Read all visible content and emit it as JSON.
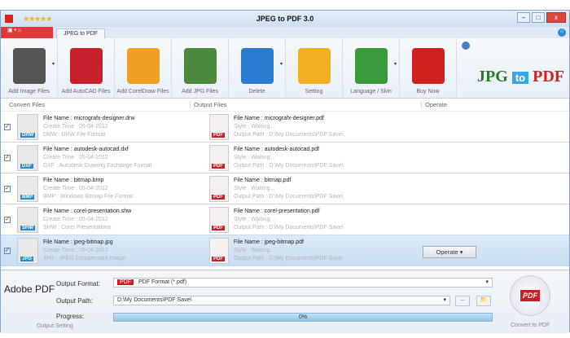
{
  "window": {
    "title": "JPEG to PDF 3.0",
    "rating": "★★★★★",
    "min": "–",
    "max": "□",
    "close": "x"
  },
  "tabs": {
    "app_menu": "▣ • ⌂",
    "active": "JPEG to PDF",
    "home": "⌂"
  },
  "toolbar": [
    {
      "label": "Add Image Files",
      "icon": "add-image-icon",
      "color": "#555555",
      "dropdown": true
    },
    {
      "label": "Add AutoCAD Files",
      "icon": "autocad-icon",
      "color": "#c8202a",
      "dropdown": false
    },
    {
      "label": "Add CorelDraw Files",
      "icon": "balloon-icon",
      "color": "#f0a020",
      "dropdown": false
    },
    {
      "label": "Add JPG Files",
      "icon": "jpg-image-icon",
      "color": "#4a8a3a",
      "dropdown": false
    },
    {
      "label": "Delete",
      "icon": "recycle-bin-icon",
      "color": "#2a7ad0",
      "dropdown": true
    },
    {
      "label": "Setting",
      "icon": "gears-icon",
      "color": "#f0b020",
      "dropdown": false
    },
    {
      "label": "Language / Skin",
      "icon": "abc-icon",
      "color": "#3a9a3a",
      "dropdown": true
    },
    {
      "label": "Buy Now",
      "icon": "gift-icon",
      "color": "#d02020",
      "dropdown": false
    }
  ],
  "logo": {
    "jpg": "JPG",
    "to": "to",
    "pdf": "PDF"
  },
  "columns": {
    "convert": "Convert Files",
    "output": "Output Files",
    "operate": "Operate"
  },
  "rows": [
    {
      "ext": "DRW",
      "name": "File Name : micrografx-designer.drw",
      "time": "Create Time : 05-04-2012",
      "type": "DRW : DRW File Format",
      "out_name": "File Name : micrografx-designer.pdf",
      "style": "Style : Waiting...",
      "path": "Output Path : D:\\My Documents\\PDF Save\\"
    },
    {
      "ext": "DXF",
      "name": "File Name : autodesk-autocad.dxf",
      "time": "Create Time : 05-04-2012",
      "type": "DXF : Autodesk Drawing Exchange Format",
      "out_name": "File Name : autodesk-autocad.pdf",
      "style": "Style : Waiting...",
      "path": "Output Path : D:\\My Documents\\PDF Save\\"
    },
    {
      "ext": "BMP",
      "name": "File Name : bitmap.bmp",
      "time": "Create Time : 05-04-2012",
      "type": "BMP : Windows Bitmap File Format",
      "out_name": "File Name : bitmap.pdf",
      "style": "Style : Waiting...",
      "path": "Output Path : D:\\My Documents\\PDF Save\\"
    },
    {
      "ext": "SHW",
      "name": "File Name : corel-presentation.shw",
      "time": "Create Time : 05-04-2012",
      "type": "SHW : Corel Presentations",
      "out_name": "File Name : corel-presentation.pdf",
      "style": "Style : Waiting...",
      "path": "Output Path : D:\\My Documents\\PDF Save\\"
    },
    {
      "ext": "JPG",
      "name": "File Name : jpeg-bitmap.jpg",
      "time": "Create Time : 05-04-2012",
      "type": "JPG : JPEG Compressed Image",
      "out_name": "File Name : jpeg-bitmap.pdf",
      "style": "Style : Waiting...",
      "path": "Output Path : D:\\My Documents\\PDF Save\\"
    }
  ],
  "operate_button": "Operate ▾",
  "pdf_badge": "PDF",
  "bottom": {
    "adobe": "Adobe PDF",
    "format_label": "Output Format:",
    "format_value": "PDF Format (*.pdf)",
    "path_label": "Output Path:",
    "path_value": "D:\\My Documents\\PDF Save\\",
    "progress_label": "Progress:",
    "progress_text": "0%",
    "progress": 0,
    "section": "Output Setting",
    "browse": "...",
    "folder": "📁",
    "convert": "Convert to PDF",
    "convert_badge": "PDF"
  }
}
